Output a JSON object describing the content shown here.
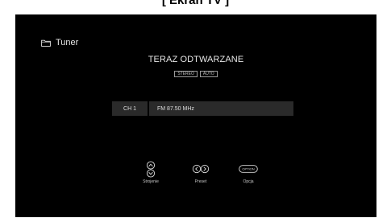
{
  "caption": "[ Ekran TV ]",
  "source": {
    "icon": "folder-icon",
    "label": "Tuner"
  },
  "now_playing": {
    "title": "TERAZ ODTWARZANE",
    "badges": [
      "STEREO",
      "AUTO"
    ]
  },
  "channel": {
    "label": "CH 1",
    "frequency": "FM 87.50 MHz"
  },
  "controls": [
    {
      "icon": "up-down-arrows-icon",
      "label": "Strojenie"
    },
    {
      "icon": "left-right-arrows-icon",
      "label": "Preset"
    },
    {
      "icon": "option-button-icon",
      "button_text": "OPTION",
      "label": "Opcja"
    }
  ],
  "colors": {
    "screen_background": "#000000",
    "bar_background": "#2a2a2a",
    "text": "#e6e6e6"
  }
}
